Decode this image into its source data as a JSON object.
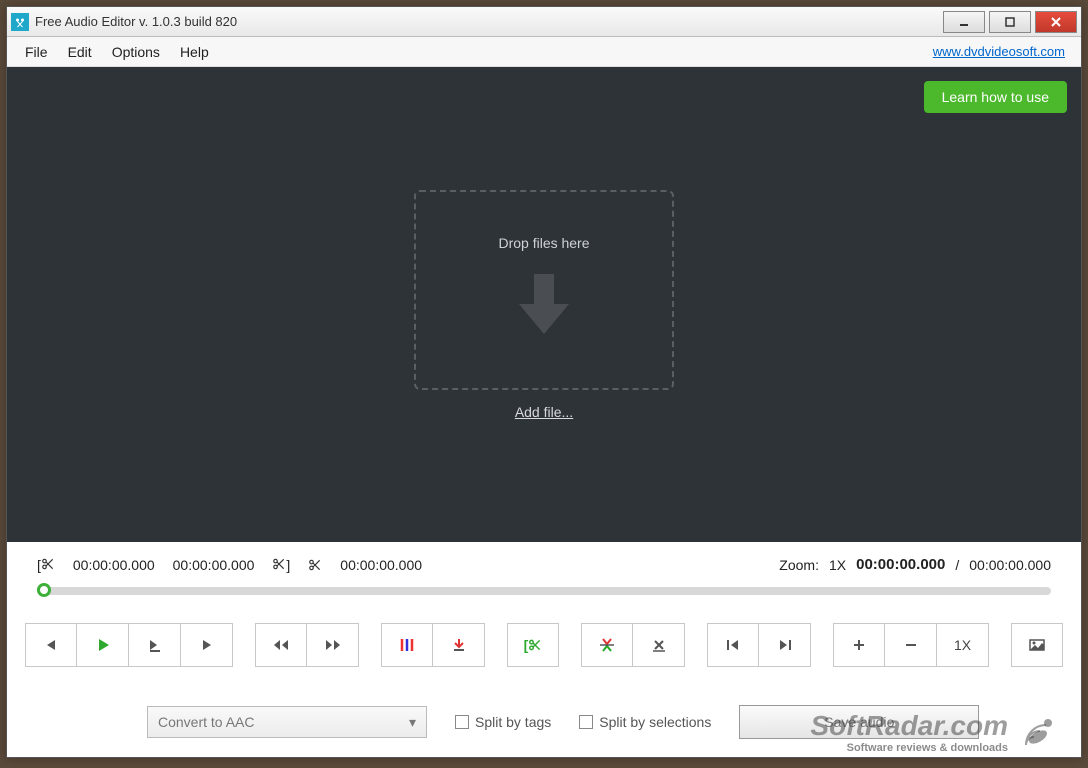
{
  "window": {
    "title": "Free Audio Editor v. 1.0.3 build 820"
  },
  "menu": {
    "file": "File",
    "edit": "Edit",
    "options": "Options",
    "help": "Help",
    "link": "www.dvdvideosoft.com"
  },
  "workspace": {
    "learn": "Learn how to use",
    "drop": "Drop files here",
    "add": "Add file..."
  },
  "status": {
    "sel_start": "00:00:00.000",
    "sel_end": "00:00:00.000",
    "clip": "00:00:00.000",
    "zoom_label": "Zoom:",
    "zoom_value": "1X",
    "current": "00:00:00.000",
    "slash": "/",
    "total": "00:00:00.000"
  },
  "toolbar": {
    "zoom_reset": "1X"
  },
  "bottom": {
    "convert": "Convert to AAC",
    "split_tags": "Split by tags",
    "split_sel": "Split by selections",
    "save": "Save audio"
  },
  "watermark": {
    "brand": "SoftRadar.com",
    "tag": "Software reviews & downloads"
  }
}
